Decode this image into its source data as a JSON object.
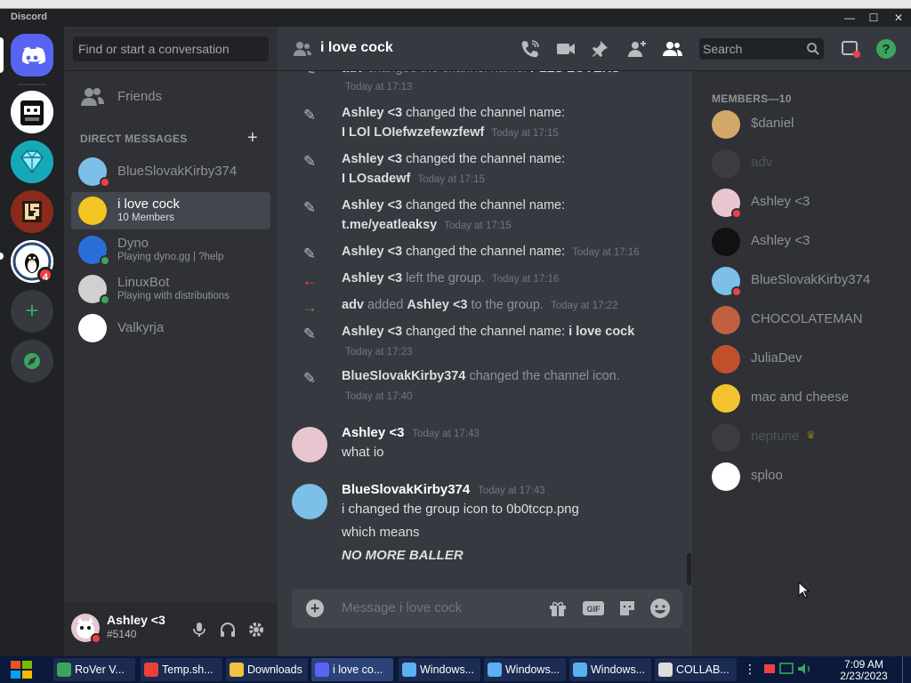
{
  "window": {
    "title": "Discord",
    "minimize": "—",
    "maximize": "☐",
    "close": "✕"
  },
  "servers": [
    {
      "name": "home",
      "color": "#5865f2"
    },
    {
      "name": "server-robot",
      "color": "#ffffff"
    },
    {
      "name": "server-diamond",
      "color": "#1abc9c"
    },
    {
      "name": "server-ls",
      "color": "#c0392b"
    },
    {
      "name": "server-linux",
      "color": "#ffffff",
      "badge": "4"
    },
    {
      "name": "add-server",
      "symbol": "+"
    },
    {
      "name": "explore",
      "symbol": "◎"
    }
  ],
  "dm": {
    "search_placeholder": "Find or start a conversation",
    "friends_label": "Friends",
    "section_label": "DIRECT MESSAGES",
    "add_symbol": "+",
    "items": [
      {
        "name": "BlueSlovakKirby374",
        "sub": "",
        "status": "dnd",
        "avatar": "#7cc0e8"
      },
      {
        "name": "i love cock",
        "sub": "10 Members",
        "status": "",
        "avatar": "#f3c623",
        "selected": true
      },
      {
        "name": "Dyno",
        "sub": "Playing dyno.gg | ?help",
        "status": "online",
        "avatar": "#2a6fd8"
      },
      {
        "name": "LinuxBot",
        "sub": "Playing with distributions",
        "status": "online",
        "avatar": "#d0d0d0"
      },
      {
        "name": "Valkyrja",
        "sub": "",
        "status": "",
        "avatar": "#ffffff"
      }
    ]
  },
  "user": {
    "name": "Ashley <3",
    "tag": "#5140"
  },
  "channel": {
    "name": "i love cock",
    "search_placeholder": "Search",
    "input_placeholder": "Message i love cock"
  },
  "messages": {
    "cut_top": {
      "who": "adv",
      "action": " changed the channel name: ",
      "value": "PLLS LOVERS",
      "time": "Today at 17:13"
    },
    "sys": [
      {
        "icon": "✎",
        "who": "Ashley <3",
        "action": " changed the channel name:",
        "value": "I LOl LOIefwzefewzfewf",
        "time": "Today at 17:15",
        "wrap": true
      },
      {
        "icon": "✎",
        "who": "Ashley <3",
        "action": " changed the channel name:",
        "value": "I LOsadewf",
        "time": "Today at 17:15",
        "wrap": true
      },
      {
        "icon": "✎",
        "who": "Ashley <3",
        "action": " changed the channel name:",
        "value": "t.me/yeatleaksy",
        "time": "Today at 17:15",
        "wrap": true
      },
      {
        "icon": "✎",
        "who": "Ashley <3",
        "action": " changed the channel name:",
        "value": "",
        "time": "Today at 17:16",
        "wrap": false
      },
      {
        "icon": "←",
        "who": "Ashley <3",
        "action": " left the group.",
        "value": "",
        "time": "Today at 17:16",
        "wrap": false,
        "color": "#ed4245"
      },
      {
        "icon": "→",
        "who": "adv",
        "action": " added ",
        "value": "Ashley <3",
        "tail": " to the group.",
        "time": "Today at 17:22",
        "wrap": false,
        "color": "#3ba55d"
      },
      {
        "icon": "✎",
        "who": "Ashley <3",
        "action": " changed the channel name: ",
        "value": "i love cock",
        "time": "Today at 17:23",
        "wrap": "time"
      },
      {
        "icon": "✎",
        "who": "BlueSlovakKirby374",
        "action": " changed the channel icon.",
        "value": "",
        "time": "Today at 17:40",
        "wrap": "time"
      }
    ],
    "chat": [
      {
        "author": "Ashley <3",
        "time": "Today at 17:43",
        "lines": [
          "what io"
        ],
        "avatar": "#e8c6cf"
      },
      {
        "author": "BlueSlovakKirby374",
        "time": "Today at 17:43",
        "lines": [
          "i changed the group icon to 0b0tccp.png",
          "which means",
          "NO MORE BALLER"
        ],
        "avatar": "#7cc0e8"
      }
    ]
  },
  "members": {
    "header": "MEMBERS—10",
    "list": [
      {
        "name": "$daniel",
        "color": "#d4a76a",
        "status": "",
        "dim": false
      },
      {
        "name": "adv",
        "color": "#555",
        "status": "",
        "dim": true
      },
      {
        "name": "Ashley <3",
        "color": "#e8c6cf",
        "status": "dnd",
        "dim": false
      },
      {
        "name": "Ashley <3",
        "color": "#111",
        "status": "",
        "dim": false
      },
      {
        "name": "BlueSlovakKirby374",
        "color": "#7cc0e8",
        "status": "dnd",
        "dim": false
      },
      {
        "name": "CHOCOLATEMAN",
        "color": "#c06040",
        "status": "",
        "dim": false
      },
      {
        "name": "JuliaDev",
        "color": "#c0502c",
        "status": "",
        "dim": false
      },
      {
        "name": "mac and cheese",
        "color": "#f2c230",
        "status": "",
        "dim": false
      },
      {
        "name": "neptune",
        "color": "#555",
        "status": "",
        "dim": true,
        "crown": "♛"
      },
      {
        "name": "sploo",
        "color": "#ffffff",
        "status": "",
        "dim": false
      }
    ]
  },
  "taskbar": {
    "items": [
      {
        "label": "RoVer V...",
        "color": "#3ba55d"
      },
      {
        "label": "Temp.sh...",
        "color": "#ea4335"
      },
      {
        "label": "Downloads",
        "color": "#f0c040"
      },
      {
        "label": "i love co...",
        "color": "#5865f2"
      },
      {
        "label": "Windows...",
        "color": "#5ab0f0"
      },
      {
        "label": "Windows...",
        "color": "#5ab0f0"
      },
      {
        "label": "Windows...",
        "color": "#5ab0f0"
      },
      {
        "label": "COLLAB...",
        "color": "#ddd"
      }
    ],
    "time": "7:09 AM",
    "date": "2/23/2023"
  },
  "colors": {
    "online": "#3ba55d",
    "dnd": "#ed4245",
    "accent": "#5865f2",
    "help": "#3ba55d"
  }
}
